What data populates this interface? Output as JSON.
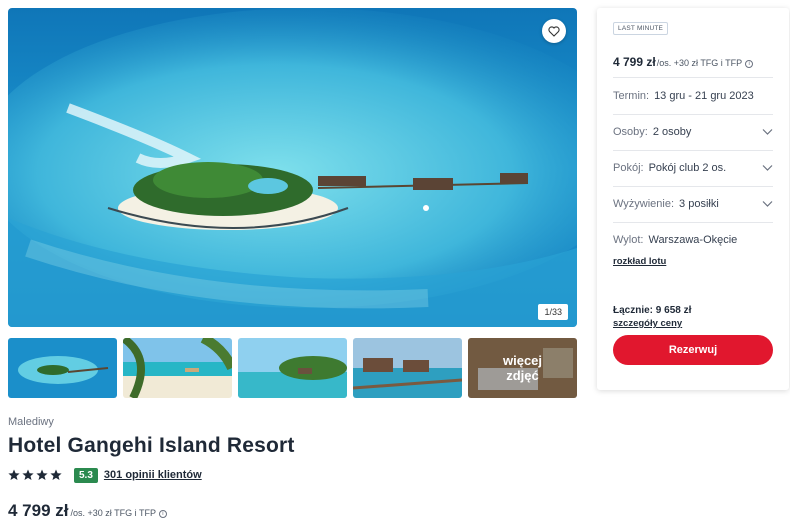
{
  "gallery": {
    "counter": "1/33",
    "more_label": "więcej zdjęć"
  },
  "hotel": {
    "country": "Malediwy",
    "name": "Hotel Gangehi Island Resort",
    "stars": 4,
    "score": "5.3",
    "reviews": "301 opinii klientów",
    "price": "4 799 zł",
    "price_unit": "/os. +30 zł TFG i TFP"
  },
  "panel": {
    "badge": "LAST MINUTE",
    "price": "4 799 zł",
    "price_unit": "/os. +30 zł TFG i TFP",
    "term_label": "Termin:",
    "term_value": "13 gru - 21 gru 2023",
    "persons_label": "Osoby:",
    "persons_value": "2 osoby",
    "room_label": "Pokój:",
    "room_value": "Pokój club 2 os.",
    "board_label": "Wyżywienie:",
    "board_value": "3 posiłki",
    "departure_label": "Wylot:",
    "departure_value": "Warszawa-Okęcie",
    "flight_link": "rozkład lotu",
    "total": "Łącznie: 9 658 zł",
    "price_details_link": "szczegóły ceny",
    "reserve": "Rezerwuj"
  },
  "colors": {
    "accent": "#e1172e",
    "score_bg": "#2b8a4f"
  }
}
